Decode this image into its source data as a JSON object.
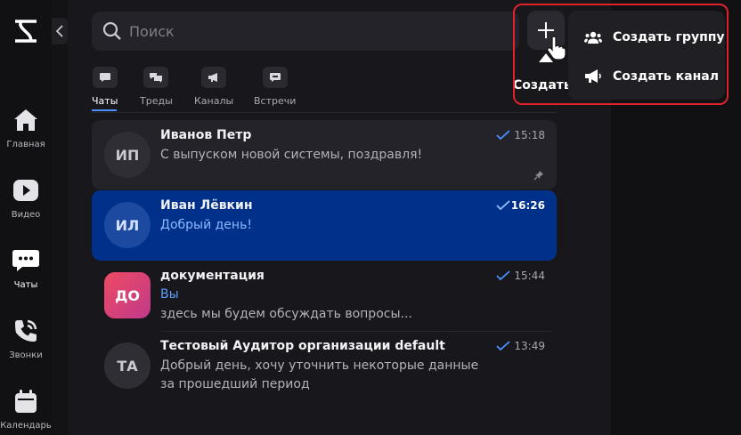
{
  "rail": {
    "items": [
      {
        "label": "Главная",
        "icon": "home-icon"
      },
      {
        "label": "Видео",
        "icon": "video-icon"
      },
      {
        "label": "Чаты",
        "icon": "chat-icon",
        "active": true
      },
      {
        "label": "Звонки",
        "icon": "phone-icon"
      },
      {
        "label": "Календарь",
        "icon": "calendar-icon"
      }
    ]
  },
  "search": {
    "placeholder": "Поиск"
  },
  "tabs": [
    {
      "label": "Чаты",
      "active": true
    },
    {
      "label": "Треды"
    },
    {
      "label": "Каналы"
    },
    {
      "label": "Встречи"
    }
  ],
  "chats": [
    {
      "initials": "ИП",
      "name": "Иванов Петр",
      "message": "С выпуском новой системы, поздравля!",
      "time": "15:18",
      "pinned": true
    },
    {
      "initials": "ИЛ",
      "name": "Иван Лёвкин",
      "message": "Добрый день!",
      "time": "16:26",
      "selected": true
    },
    {
      "initials": "ДО",
      "name": "документация",
      "sender": "Вы",
      "message": "здесь мы будем обсуждать вопросы...",
      "time": "15:44"
    },
    {
      "initials": "ТА",
      "name": "Тестовый Аудитор организации default",
      "message": "Добрый день, хочу уточнить некоторые данные",
      "message2": "за прошедший период",
      "time": "13:49"
    }
  ],
  "create": {
    "tooltip": "Создать"
  },
  "menu": {
    "items": [
      {
        "label": "Создать группу",
        "icon": "group-icon"
      },
      {
        "label": "Создать канал",
        "icon": "megaphone-icon"
      }
    ]
  },
  "colors": {
    "accent": "#4a90ff",
    "selected_row": "#00318a",
    "highlight": "#e0222b"
  }
}
